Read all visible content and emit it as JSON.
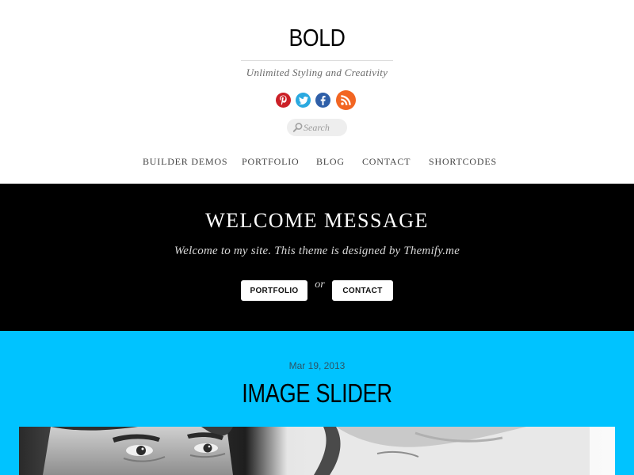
{
  "header": {
    "site_title": "BOLD",
    "tagline": "Unlimited Styling and Creativity",
    "social": [
      {
        "name": "pinterest",
        "icon": "pinterest-icon",
        "color": "#cb2027"
      },
      {
        "name": "twitter",
        "icon": "twitter-icon",
        "color": "#2aa9e0"
      },
      {
        "name": "facebook",
        "icon": "facebook-icon",
        "color": "#2f5fa8"
      },
      {
        "name": "rss",
        "icon": "rss-icon",
        "color": "#f26522"
      }
    ],
    "search": {
      "placeholder": "Search",
      "value": ""
    }
  },
  "nav": {
    "items": [
      {
        "label": "BUILDER DEMOS"
      },
      {
        "label": "PORTFOLIO"
      },
      {
        "label": "BLOG"
      },
      {
        "label": "CONTACT"
      },
      {
        "label": "SHORTCODES"
      }
    ]
  },
  "welcome": {
    "title": "WELCOME MESSAGE",
    "text": "Welcome to my site. This theme is designed by Themify.me",
    "portfolio_button": "PORTFOLIO",
    "or_text": "or",
    "contact_button": "CONTACT",
    "background": "#000000"
  },
  "post": {
    "date": "Mar 19, 2013",
    "title": "IMAGE SLIDER",
    "background": "#00c3ff"
  }
}
